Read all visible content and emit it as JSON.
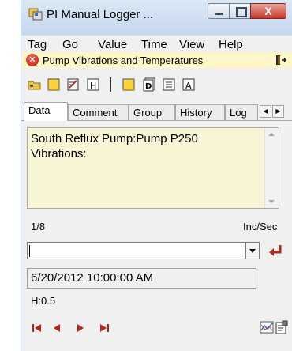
{
  "window": {
    "title": "PI Manual Logger ...",
    "close_glyph": "X"
  },
  "menu": [
    "Tag",
    "Go",
    "Value",
    "Time",
    "View",
    "Help"
  ],
  "status": {
    "message": "Pump Vibrations and Temperatures",
    "icon": "error-icon",
    "error_glyph": "✕"
  },
  "toolbar": {
    "icons": [
      "open-folder-icon",
      "new-icon",
      "edit-icon",
      "history-h-icon",
      "note-icon",
      "document-d-icon",
      "document-lines-icon",
      "document-a-icon"
    ]
  },
  "tabs": [
    "Data",
    "Comment",
    "Group",
    "History",
    "Log"
  ],
  "data_tab": {
    "description": "South Reflux Pump:Pump P250\nVibrations:",
    "position": "1/8",
    "units": "Inc/Sec",
    "value": "",
    "timestamp": "6/20/2012 10:00:00 AM",
    "limits": "H:0.5"
  },
  "colors": {
    "note_bg": "#f8f5d5",
    "status_bg": "#fff6c8",
    "accent_red": "#c0392b",
    "nav_red": "#b5271e"
  }
}
